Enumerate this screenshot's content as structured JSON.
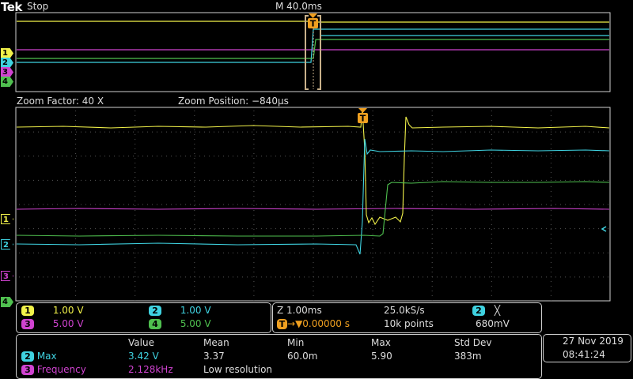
{
  "header": {
    "brand": "Tek",
    "run_state": "Stop",
    "horizontal_scale": "M 40.0ms"
  },
  "zoom": {
    "factor_label": "Zoom Factor: 40 X",
    "position_label": "Zoom Position: −840μs"
  },
  "channel_markers": [
    "1",
    "2",
    "3",
    "4"
  ],
  "trigger_marker": "T",
  "colors": {
    "ch1": "#f2f24a",
    "ch2": "#3fd2e0",
    "ch3": "#d043d0",
    "ch4": "#4fc04f",
    "grid": "#444444",
    "border": "#cfcfcf"
  },
  "channels": [
    {
      "num": "1",
      "scale": "1.00 V"
    },
    {
      "num": "2",
      "scale": "1.00 V"
    },
    {
      "num": "3",
      "scale": "5.00 V"
    },
    {
      "num": "4",
      "scale": "5.00 V"
    }
  ],
  "timebase": {
    "zoom_scale": "Z 1.00ms",
    "sample_rate": "25.0kS/s",
    "trigger_source": "2",
    "trigger_symbol": "╳",
    "trigger_pos": "▼0.00000 s",
    "record_length": "10k points",
    "trigger_level": "680mV"
  },
  "measurements": {
    "headers": [
      "Value",
      "Mean",
      "Min",
      "Max",
      "Std Dev"
    ],
    "rows": [
      {
        "ch": "2",
        "name": "Max",
        "value": "3.42 V",
        "mean": "3.37",
        "min": "60.0m",
        "max": "5.90",
        "std": "383m"
      },
      {
        "ch": "3",
        "name": "Frequency",
        "value": "2.128kHz",
        "mean": "Low resolution",
        "min": "",
        "max": "",
        "std": ""
      }
    ]
  },
  "datetime": {
    "date": "27 Nov 2019",
    "time": "08:41:24"
  }
}
